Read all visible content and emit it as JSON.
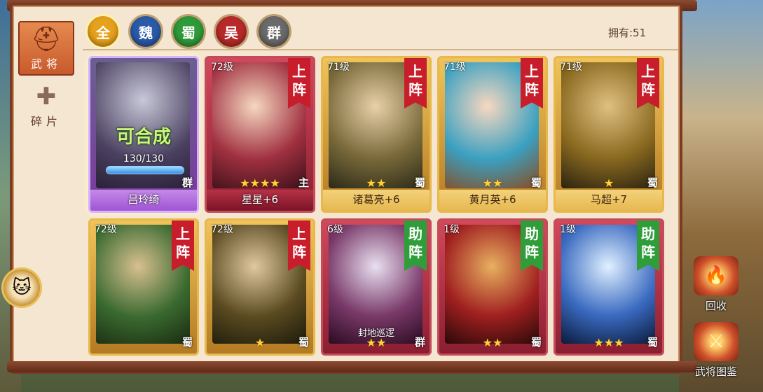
{
  "sidebar": {
    "tabs": [
      {
        "label": "武将",
        "icon": "helmet-icon",
        "active": true
      },
      {
        "label": "碎片",
        "icon": "puzzle-piece-icon",
        "active": false
      }
    ]
  },
  "filters": [
    {
      "label": "全",
      "color": "#e6a21c",
      "active": true
    },
    {
      "label": "魏",
      "color": "#2a5aa8",
      "active": false
    },
    {
      "label": "蜀",
      "color": "#2f9a3a",
      "active": false
    },
    {
      "label": "吴",
      "color": "#b82a2a",
      "active": false
    },
    {
      "label": "群",
      "color": "#6a6a6a",
      "active": false
    }
  ],
  "owned_text": "拥有:51",
  "cards": [
    {
      "name": "吕玲绮",
      "style": "purple",
      "synth_label": "可合成",
      "progress_text": "130/130",
      "progress": 1.0,
      "faction": "群"
    },
    {
      "name": "星星+6",
      "style": "red",
      "level": "72级",
      "badge": "上阵",
      "badge_color": "red",
      "stars": 4,
      "faction": "主"
    },
    {
      "name": "诸葛亮+6",
      "style": "gold",
      "level": "71级",
      "badge": "上阵",
      "badge_color": "red",
      "stars": 2,
      "faction": "蜀"
    },
    {
      "name": "黄月英+6",
      "style": "gold",
      "level": "71级",
      "badge": "上阵",
      "badge_color": "red",
      "stars": 2,
      "faction": "蜀"
    },
    {
      "name": "马超+7",
      "style": "gold",
      "level": "71级",
      "badge": "上阵",
      "badge_color": "red",
      "stars": 1,
      "faction": "蜀"
    },
    {
      "name": "",
      "style": "gold",
      "level": "72级",
      "badge": "上阵",
      "badge_color": "red",
      "stars": 0,
      "faction": "蜀"
    },
    {
      "name": "",
      "style": "gold",
      "level": "72级",
      "badge": "上阵",
      "badge_color": "red",
      "stars": 1,
      "faction": "蜀"
    },
    {
      "name": "",
      "style": "red",
      "level": "6级",
      "badge": "助阵",
      "badge_color": "green",
      "stars": 2,
      "faction": "群",
      "skill": "封地巡逻"
    },
    {
      "name": "",
      "style": "red",
      "level": "1级",
      "badge": "助阵",
      "badge_color": "green",
      "stars": 2,
      "faction": "蜀"
    },
    {
      "name": "",
      "style": "red",
      "level": "1级",
      "badge": "助阵",
      "badge_color": "green",
      "stars": 3,
      "faction": "蜀"
    }
  ],
  "actions": [
    {
      "label": "回收",
      "icon": "furnace-icon"
    },
    {
      "label": "武将图鉴",
      "icon": "codex-icon"
    }
  ],
  "colors": {
    "panel_bg": "#f4e6d0",
    "frame": "#7a3a25",
    "accent": "#e58a4f"
  }
}
